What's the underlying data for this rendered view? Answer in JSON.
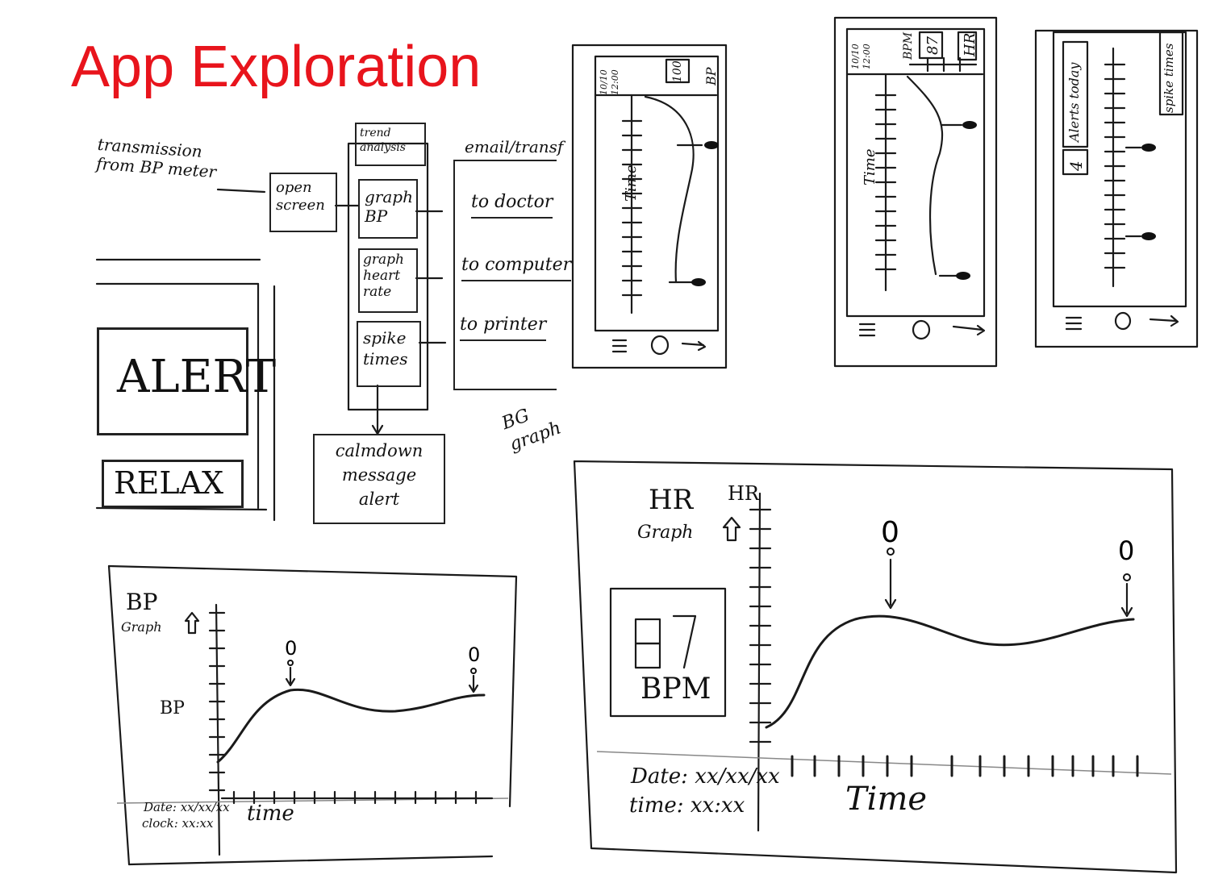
{
  "title": "App Exploration",
  "flow": {
    "source": "transmission from BP meter",
    "open_screen": "open screen",
    "trend": "trend analysis",
    "graph_bp": "graph BP",
    "graph_hr": "graph heart rate",
    "spike": "spike times",
    "email_header": "email/transf",
    "to_doctor": "to doctor",
    "to_computer": "to computer",
    "to_printer": "to printer",
    "calmdown": "calmdown message alert",
    "bg_graph": "BG graph"
  },
  "alert_screen": {
    "alert": "ALERT",
    "relax": "RELAX"
  },
  "phones": {
    "bp": {
      "date": "10/10",
      "time": "12:00",
      "value": "100",
      "label": "BP",
      "axis": "Time"
    },
    "hr": {
      "date": "10/10",
      "time": "12:00",
      "unit": "BPM",
      "value": "87",
      "label": "HR",
      "axis": "Time"
    },
    "spike": {
      "alerts_label": "Alerts today",
      "alerts_count": "4",
      "label": "spike times"
    }
  },
  "bp_graph": {
    "title1": "BP",
    "title2": "Graph",
    "ylabel": "BP",
    "xlabel": "time",
    "date": "Date: xx/xx/xx",
    "clock": "clock: xx:xx"
  },
  "hr_graph": {
    "title1": "HR",
    "title2": "Graph",
    "ylabel": "HR",
    "value": "87",
    "unit": "BPM",
    "xlabel": "Time",
    "date": "Date: xx/xx/xx",
    "time": "time: xx:xx"
  }
}
